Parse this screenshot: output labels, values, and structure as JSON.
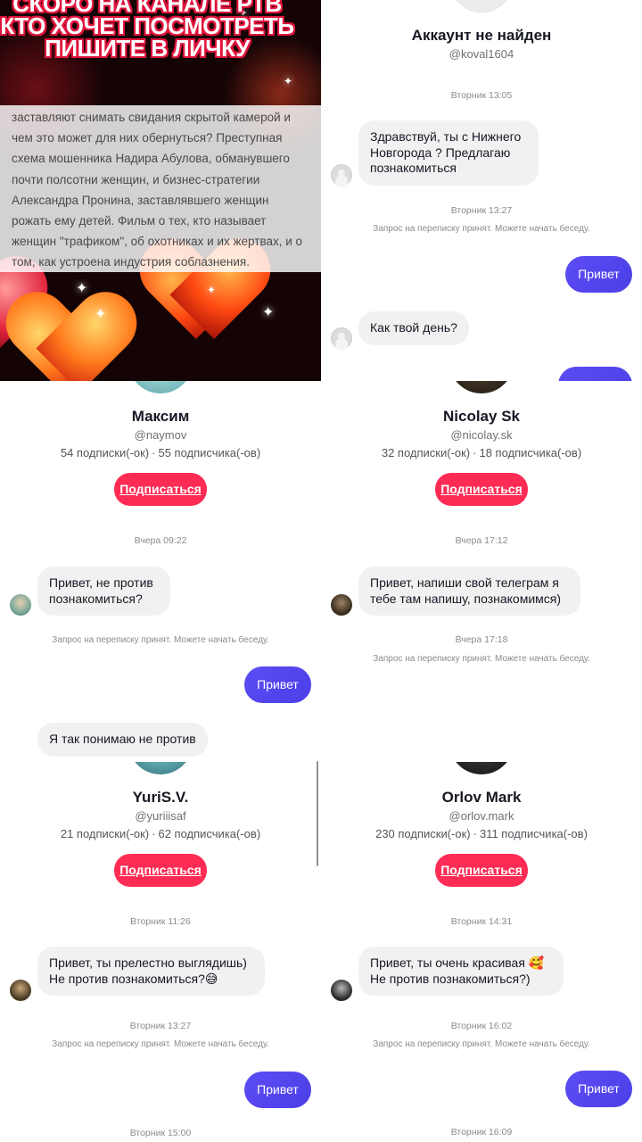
{
  "video": {
    "title": "СКОРО НА КАНАЛЕ РТВ КТО ХОЧЕТ ПОСМОТРЕТЬ ПИШИТЕ В ЛИЧКУ",
    "description": "заставляют снимать свидания скрытой камерой и чем это может для них обернуться? Преступная схема мошенника Надира Абулова, обманувшего почти полсотни женщин, и бизнес-стратегии Александра Пронина, заставлявшего женщин рожать ему детей. Фильм о тех, кто называет женщин \"трафиком\", об охотниках и их жертвах, и о том, как устроена индустрия соблазнения."
  },
  "chat_not_found": {
    "name": "Аккаунт не найден",
    "handle": "@koval1604",
    "time1": "Вторник 13:05",
    "msg1": "Здравствуй, ты с Нижнего Новгорода ? Предлагаю познакомиться",
    "time2": "Вторник 13:27",
    "note": "Запрос на переписку принят. Можете начать беседу.",
    "reply": "Привет",
    "msg2": "Как твой день?"
  },
  "chat_maxim": {
    "name": "Максим",
    "handle": "@naymov",
    "following": "54 подписки(-ок)",
    "followers": "55 подписчика(-ов)",
    "follow_label": "Подписаться",
    "time1": "Вчера 09:22",
    "msg1": "Привет, не против познакомиться?",
    "note": "Запрос на переписку принят. Можете начать беседу.",
    "reply": "Привет",
    "msg2": "Я так понимаю не против"
  },
  "chat_nicolay": {
    "name": "Nicolay Sk",
    "handle": "@nicolay.sk",
    "following": "32 подписки(-ок)",
    "followers": "18 подписчика(-ов)",
    "follow_label": "Подписаться",
    "time1": "Вчера 17:12",
    "msg1": "Привет, напиши свой телеграм я тебе там напишу, познакомимся)",
    "time2": "Вчера 17:18",
    "note": "Запрос на переписку принят. Можете начать беседу."
  },
  "chat_yuri": {
    "name": "YuriS.V.",
    "handle": "@yuriiisaf",
    "following": "21 подписки(-ок)",
    "followers": "62 подписчика(-ов)",
    "follow_label": "Подписаться",
    "time1": "Вторник 11:26",
    "msg1": "Привет, ты прелестно выглядишь) Не против познакомиться?😅",
    "time2": "Вторник 13:27",
    "note": "Запрос на переписку принят. Можете начать беседу.",
    "reply": "Привет",
    "time3": "Вторник 15:00"
  },
  "chat_orlov": {
    "name": "Orlov Mark",
    "handle": "@orlov.mark",
    "following": "230 подписки(-ок)",
    "followers": "311 подписчика(-ов)",
    "follow_label": "Подписаться",
    "time1": "Вторник 14:31",
    "msg1": "Привет, ты очень красивая 🥰 Не против познакомиться?)",
    "time2": "Вторник 16:02",
    "note": "Запрос на переписку принят. Можете начать беседу.",
    "reply": "Привет",
    "time3": "Вторник 16:09"
  },
  "stat_separator": "·",
  "colors": {
    "follow_button": "#fe2c55",
    "sent_bubble": "#5b4cf0",
    "received_bubble": "#f1f1f2",
    "caption_outline": "#e0143c"
  }
}
